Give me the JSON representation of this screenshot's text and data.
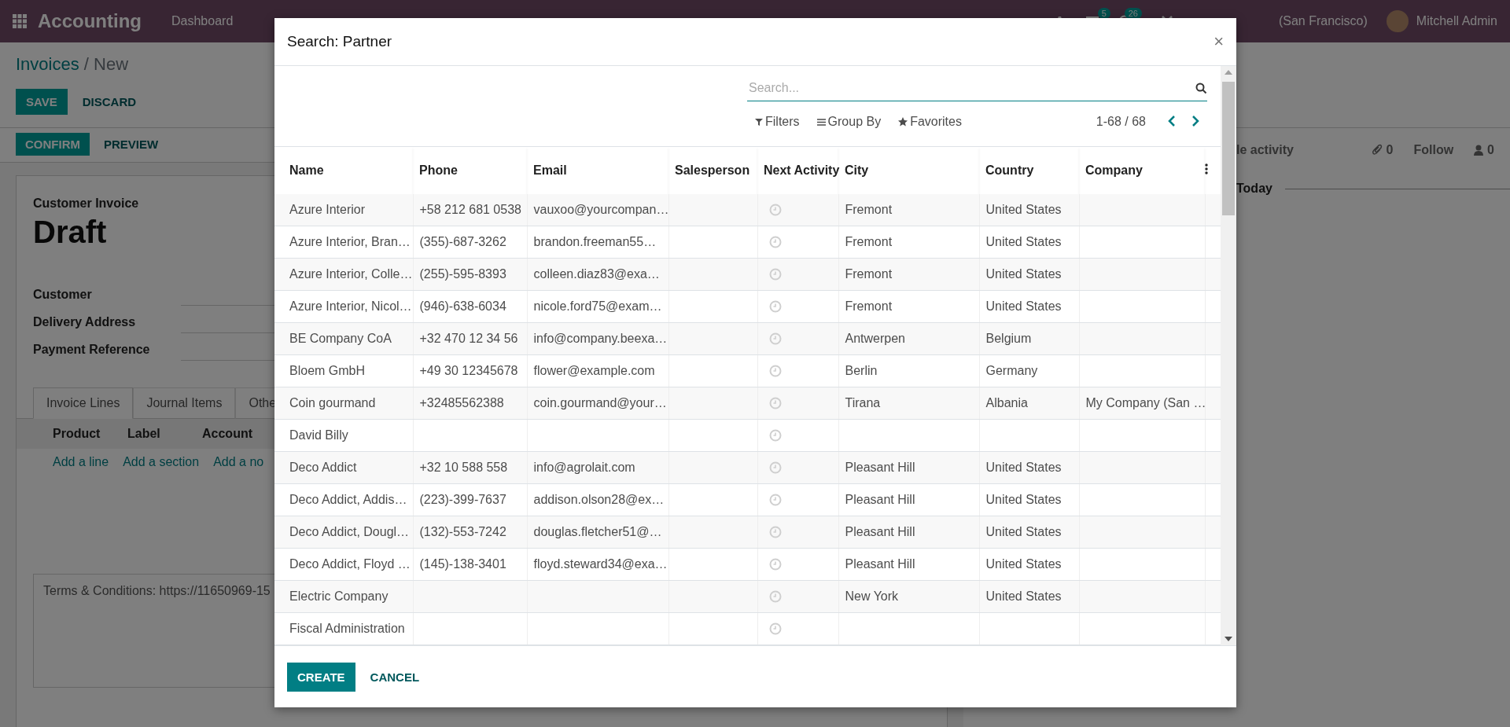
{
  "navbar": {
    "app_name": "Accounting",
    "menu": [
      "Dashboard"
    ],
    "chat_badge": "5",
    "activity_badge": "26",
    "company": "(San Francisco)",
    "user": "Mitchell Admin"
  },
  "breadcrumb": {
    "parent": "Invoices",
    "separator": "/",
    "current": "New"
  },
  "form_buttons": [
    {
      "label": "SAVE",
      "kind": "primary"
    },
    {
      "label": "DISCARD",
      "kind": "link"
    }
  ],
  "status_buttons": [
    {
      "label": "CONFIRM",
      "kind": "primary"
    },
    {
      "label": "PREVIEW",
      "kind": "link"
    }
  ],
  "invoice": {
    "type": "Customer Invoice",
    "state": "Draft",
    "fields": [
      "Customer",
      "Delivery Address",
      "Payment Reference"
    ],
    "tabs": [
      {
        "label": "Invoice Lines",
        "selected": true
      },
      {
        "label": "Journal Items",
        "selected": false
      },
      {
        "label": "Othe",
        "selected": false
      }
    ],
    "line_columns": [
      "Product",
      "Label",
      "Account"
    ],
    "line_links": [
      "Add a line",
      "Add a section",
      "Add a no"
    ],
    "terms": "Terms & Conditions: https://11650969-15"
  },
  "chatter": {
    "schedule": "le activity",
    "attachments": "0",
    "follow": "Follow",
    "followers": "0",
    "date_separator": "Today"
  },
  "dialog": {
    "title": "Search: Partner",
    "close": "×",
    "search": {
      "placeholder": "Search..."
    },
    "filters": [
      "Filters",
      "Group By",
      "Favorites"
    ],
    "pager": "1-68 / 68",
    "columns": [
      "Name",
      "Phone",
      "Email",
      "Salesperson",
      "Next Activity",
      "City",
      "Country",
      "Company"
    ],
    "rows": [
      {
        "name": "Azure Interior",
        "phone": "+58 212 681 0538",
        "email": "vauxoo@yourcompan…",
        "city": "Fremont",
        "country": "United States"
      },
      {
        "name": "Azure Interior, Bran…",
        "phone": "(355)-687-3262",
        "email": "brandon.freeman55…",
        "city": "Fremont",
        "country": "United States"
      },
      {
        "name": "Azure Interior, Colle…",
        "phone": "(255)-595-8393",
        "email": "colleen.diaz83@exa…",
        "city": "Fremont",
        "country": "United States"
      },
      {
        "name": "Azure Interior, Nicol…",
        "phone": "(946)-638-6034",
        "email": "nicole.ford75@exam…",
        "city": "Fremont",
        "country": "United States"
      },
      {
        "name": "BE Company CoA",
        "phone": "+32 470 12 34 56",
        "email": "info@company.beexa…",
        "city": "Antwerpen",
        "country": "Belgium"
      },
      {
        "name": "Bloem GmbH",
        "phone": "+49 30 12345678",
        "email": "flower@example.com",
        "city": "Berlin",
        "country": "Germany"
      },
      {
        "name": "Coin gourmand",
        "phone": "+32485562388",
        "email": "coin.gourmand@your…",
        "city": "Tirana",
        "country": "Albania",
        "company": "My Company (San …"
      },
      {
        "name": "David Billy"
      },
      {
        "name": "Deco Addict",
        "phone": "+32 10 588 558",
        "email": "info@agrolait.com",
        "city": "Pleasant Hill",
        "country": "United States"
      },
      {
        "name": "Deco Addict, Addis…",
        "phone": "(223)-399-7637",
        "email": "addison.olson28@ex…",
        "city": "Pleasant Hill",
        "country": "United States"
      },
      {
        "name": "Deco Addict, Dougl…",
        "phone": "(132)-553-7242",
        "email": "douglas.fletcher51@…",
        "city": "Pleasant Hill",
        "country": "United States"
      },
      {
        "name": "Deco Addict, Floyd …",
        "phone": "(145)-138-3401",
        "email": "floyd.steward34@exa…",
        "city": "Pleasant Hill",
        "country": "United States"
      },
      {
        "name": "Electric Company",
        "city": "New York",
        "country": "United States"
      },
      {
        "name": "Fiscal Administration"
      }
    ],
    "buttons": [
      {
        "label": "CREATE",
        "kind": "primary"
      },
      {
        "label": "CANCEL",
        "kind": "link"
      }
    ]
  }
}
